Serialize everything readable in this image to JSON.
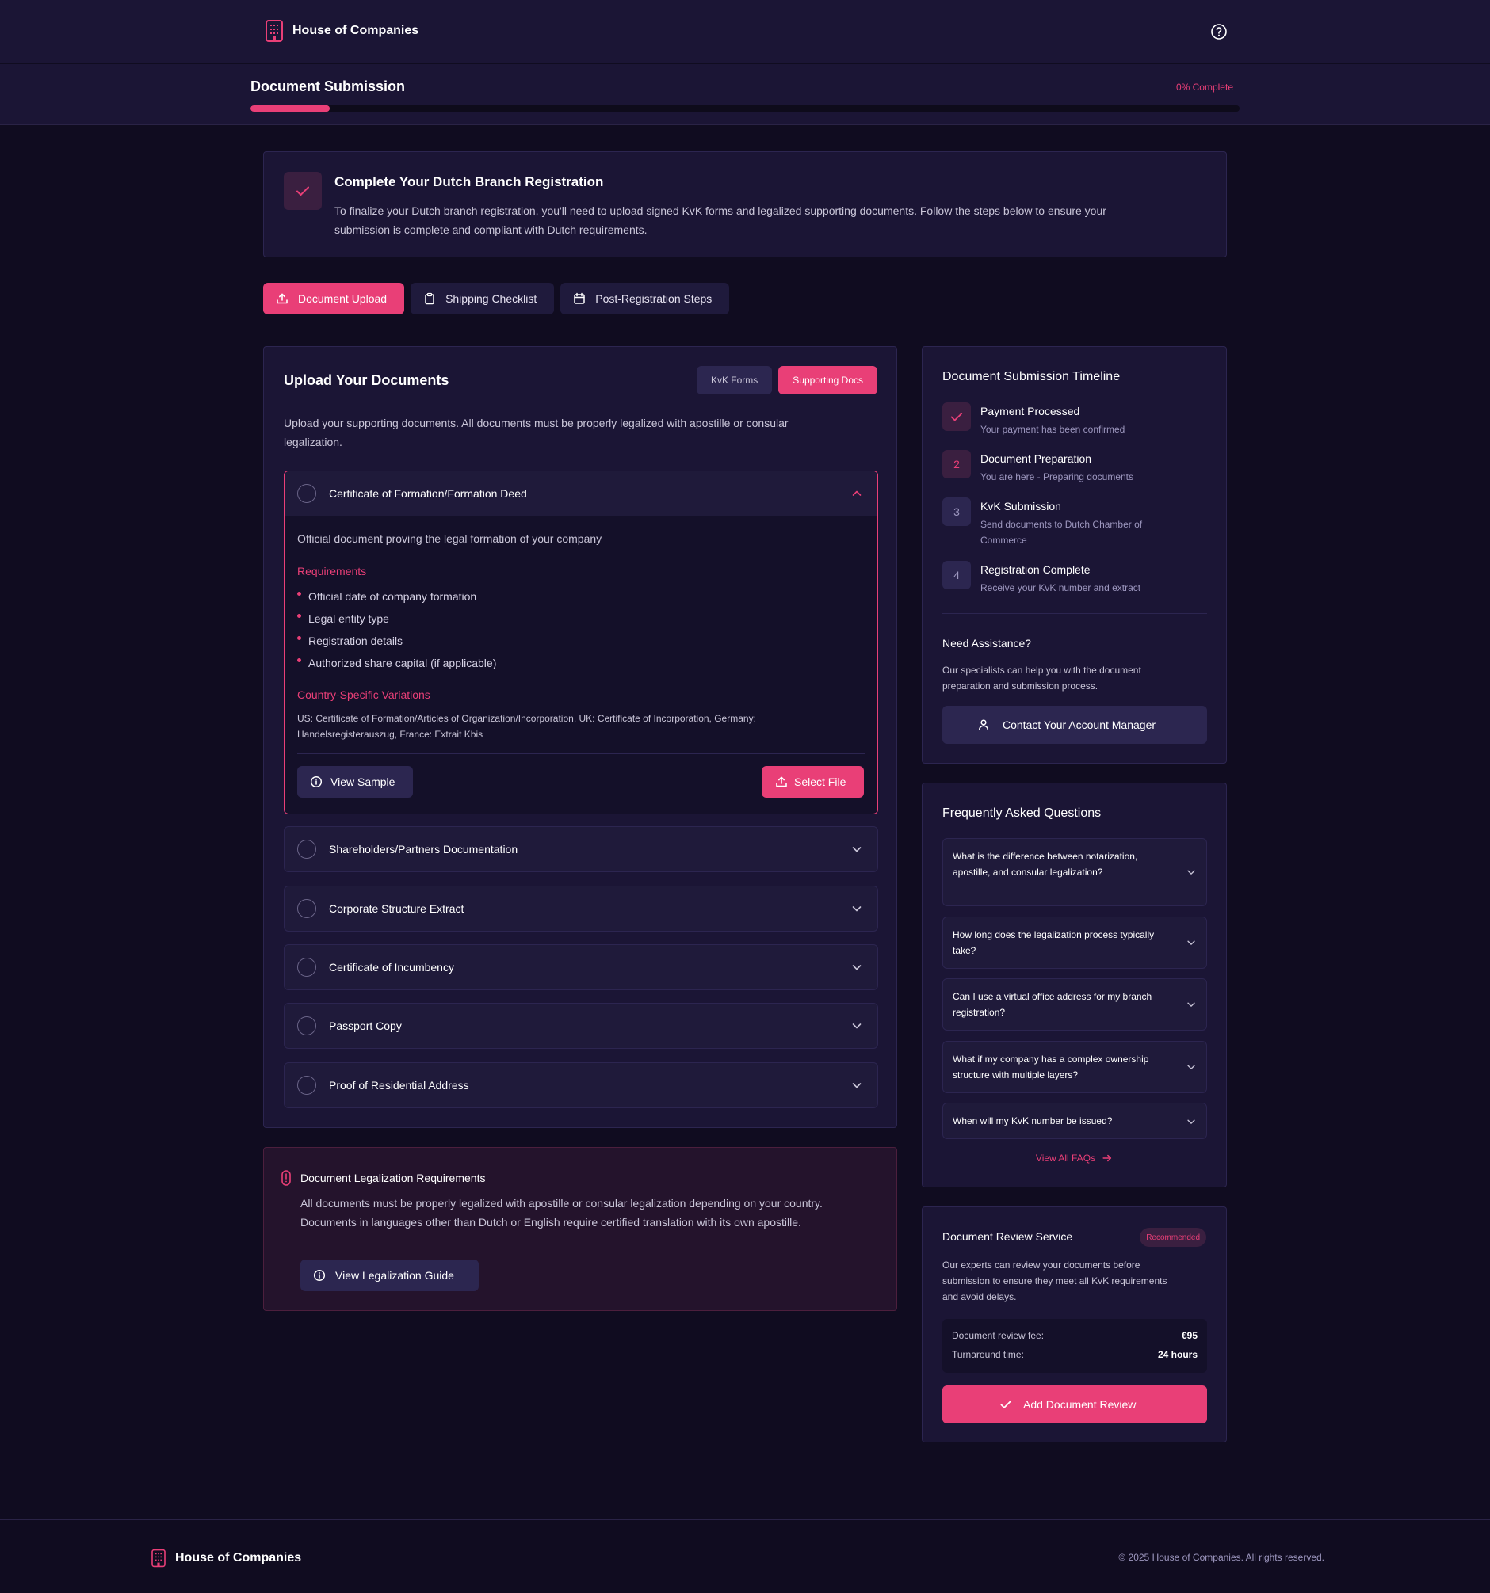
{
  "brand": {
    "name": "House of Companies"
  },
  "progress": {
    "title": "Document Submission",
    "label": "0% Complete",
    "fill_fraction": 0.08
  },
  "intro": {
    "title": "Complete Your Dutch Branch Registration",
    "text": "To finalize your Dutch branch registration, you'll need to upload signed KvK forms and legalized supporting documents. Follow the steps below to ensure your submission is complete and compliant with Dutch requirements."
  },
  "tabs": [
    {
      "label": "Document Upload",
      "icon": "upload-icon",
      "active": true
    },
    {
      "label": "Shipping Checklist",
      "icon": "clipboard-icon",
      "active": false
    },
    {
      "label": "Post-Registration Steps",
      "icon": "calendar-icon",
      "active": false
    }
  ],
  "upload": {
    "title": "Upload Your Documents",
    "seg": [
      {
        "label": "KvK Forms",
        "active": false
      },
      {
        "label": "Supporting Docs",
        "active": true
      }
    ],
    "description": "Upload your supporting documents. All documents must be properly legalized with apostille or consular legalization.",
    "open_item": {
      "title": "Certificate of Formation/Formation Deed",
      "description": "Official document proving the legal formation of your company",
      "requirements_title": "Requirements",
      "requirements": [
        "Official date of company formation",
        "Legal entity type",
        "Registration details",
        "Authorized share capital (if applicable)"
      ],
      "variations_title": "Country-Specific Variations",
      "variations_text": "US: Certificate of Formation/Articles of Organization/Incorporation, UK: Certificate of Incorporation, Germany: Handelsregisterauszug, France: Extrait Kbis",
      "view_sample": "View Sample",
      "select_file": "Select File"
    },
    "items": [
      "Shareholders/Partners Documentation",
      "Corporate Structure Extract",
      "Certificate of Incumbency",
      "Passport Copy",
      "Proof of Residential Address"
    ]
  },
  "legalization": {
    "title": "Document Legalization Requirements",
    "text": "All documents must be properly legalized with apostille or consular legalization depending on your country. Documents in languages other than Dutch or English require certified translation with its own apostille.",
    "button": "View Legalization Guide"
  },
  "timeline": {
    "title": "Document Submission Timeline",
    "steps": [
      {
        "badge": "",
        "state": "done",
        "title": "Payment Processed",
        "subtitle": "Your payment has been confirmed"
      },
      {
        "badge": "2",
        "state": "current",
        "title": "Document Preparation",
        "subtitle": "You are here - Preparing documents"
      },
      {
        "badge": "3",
        "state": "pending",
        "title": "KvK Submission",
        "subtitle": "Send documents to Dutch Chamber of Commerce"
      },
      {
        "badge": "4",
        "state": "pending",
        "title": "Registration Complete",
        "subtitle": "Receive your KvK number and extract"
      }
    ],
    "assist_title": "Need Assistance?",
    "assist_text": "Our specialists can help you with the document preparation and submission process.",
    "contact_button": "Contact Your Account Manager"
  },
  "faq": {
    "title": "Frequently Asked Questions",
    "questions": [
      "What is the difference between notarization, apostille, and consular legalization?",
      "How long does the legalization process typically take?",
      "Can I use a virtual office address for my branch registration?",
      "What if my company has a complex ownership structure with multiple layers?",
      "When will my KvK number be issued?"
    ],
    "view_all": "View All FAQs"
  },
  "review": {
    "title": "Document Review Service",
    "badge": "Recommended",
    "text": "Our experts can review your documents before submission to ensure they meet all KvK requirements and avoid delays.",
    "fee_label": "Document review fee:",
    "fee_value": "€95",
    "turnaround_label": "Turnaround time:",
    "turnaround_value": "24 hours",
    "button": "Add Document Review"
  },
  "footer": {
    "copyright": "© 2025 House of Companies. All rights reserved."
  },
  "colors": {
    "accent": "#e93f77",
    "background": "#100c20",
    "card": "#1b1535"
  }
}
